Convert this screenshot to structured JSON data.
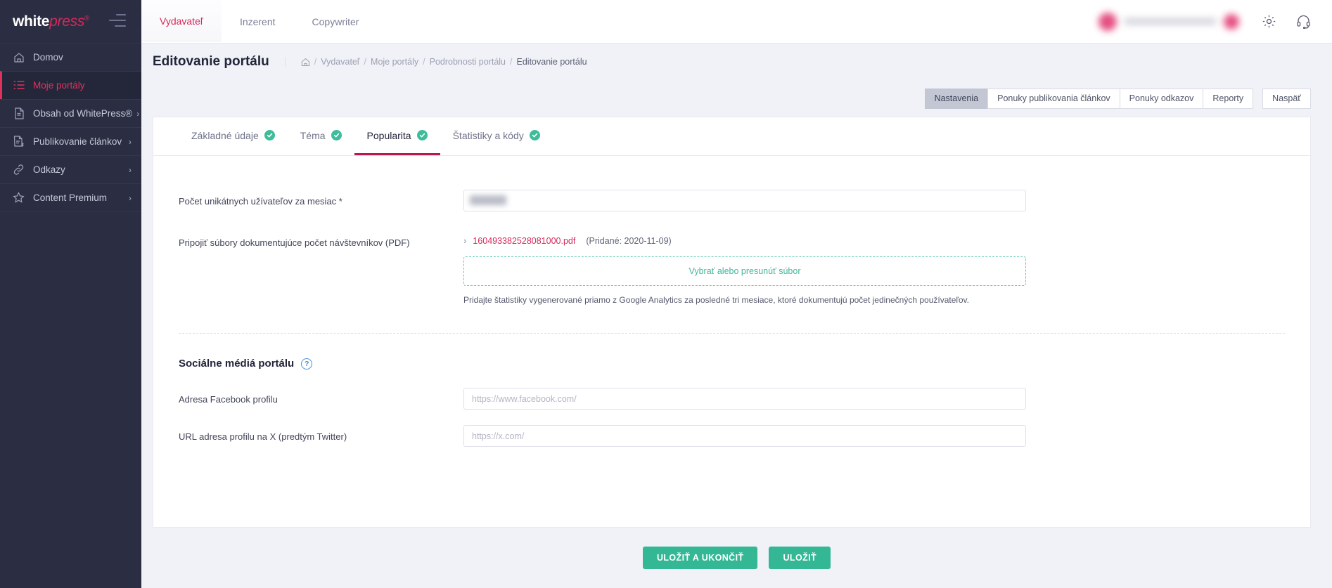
{
  "sidebar": {
    "logo": {
      "part1": "white",
      "part2": "press",
      "reg": "®"
    },
    "items": [
      {
        "label": "Domov",
        "icon": "home-icon",
        "chevron": "",
        "active": false
      },
      {
        "label": "Moje portály",
        "icon": "list-icon",
        "chevron": "",
        "active": true
      },
      {
        "label": "Obsah od WhitePress®",
        "icon": "document-icon",
        "chevron": "›",
        "active": false
      },
      {
        "label": "Publikovanie článkov",
        "icon": "document-dollar-icon",
        "chevron": "›",
        "active": false
      },
      {
        "label": "Odkazy",
        "icon": "link-icon",
        "chevron": "›",
        "active": false
      },
      {
        "label": "Content Premium",
        "icon": "star-icon",
        "chevron": "›",
        "active": false
      }
    ]
  },
  "topbar": {
    "tabs": [
      {
        "label": "Vydavateľ",
        "active": true
      },
      {
        "label": "Inzerent",
        "active": false
      },
      {
        "label": "Copywriter",
        "active": false
      }
    ],
    "icons": [
      {
        "name": "gear-icon"
      },
      {
        "name": "headset-icon"
      }
    ]
  },
  "pagehead": {
    "title": "Editovanie portálu",
    "breadcrumb": [
      {
        "label": "Vydavateľ",
        "current": false
      },
      {
        "label": "Moje portály",
        "current": false
      },
      {
        "label": "Podrobnosti portálu",
        "current": false
      },
      {
        "label": "Editovanie portálu",
        "current": true
      }
    ],
    "separator": "/"
  },
  "portalrow": {
    "portal_name": "",
    "buttons": [
      {
        "label": "Nastavenia",
        "selected": true
      },
      {
        "label": "Ponuky publikovania článkov",
        "selected": false
      },
      {
        "label": "Ponuky odkazov",
        "selected": false
      },
      {
        "label": "Reporty",
        "selected": false
      }
    ],
    "back_label": "Naspäť"
  },
  "tabs": [
    {
      "label": "Základné údaje",
      "done": true,
      "active": false
    },
    {
      "label": "Téma",
      "done": true,
      "active": false
    },
    {
      "label": "Popularita",
      "done": true,
      "active": true
    },
    {
      "label": "Štatistiky a kódy",
      "done": true,
      "active": false
    }
  ],
  "form": {
    "unique_users": {
      "label": "Počet unikátnych užívateľov za mesiac *",
      "value": "",
      "placeholder": ""
    },
    "attach": {
      "label": "Pripojiť súbory dokumentujúce počet návštevníkov (PDF)",
      "file_arrow": "›",
      "file_name": "160493382528081000.pdf",
      "file_added": "(Pridané: 2020-11-09)",
      "dropzone_label": "Vybrať alebo presunúť súbor",
      "hint": "Pridajte štatistiky vygenerované priamo z Google Analytics za posledné tri mesiace, ktoré dokumentujú počet jedinečných používateľov."
    },
    "social": {
      "title": "Sociálne médiá portálu",
      "help_icon": "?",
      "facebook": {
        "label": "Adresa Facebook profilu",
        "value": "",
        "placeholder": "https://www.facebook.com/"
      },
      "twitter": {
        "label": "URL adresa profilu na X (predtým Twitter)",
        "value": "",
        "placeholder": "https://x.com/"
      }
    }
  },
  "footer": {
    "save_and_exit": "ULOŽIŤ A UKONČIŤ",
    "save": "ULOŽIŤ"
  },
  "colors": {
    "brand_pink": "#d6285a",
    "sidebar_bg": "#2b2e42",
    "accent_green": "#33b795",
    "tab_underline": "#c0174b",
    "check_green": "#3ebd9a",
    "help_blue": "#4a90d9"
  }
}
